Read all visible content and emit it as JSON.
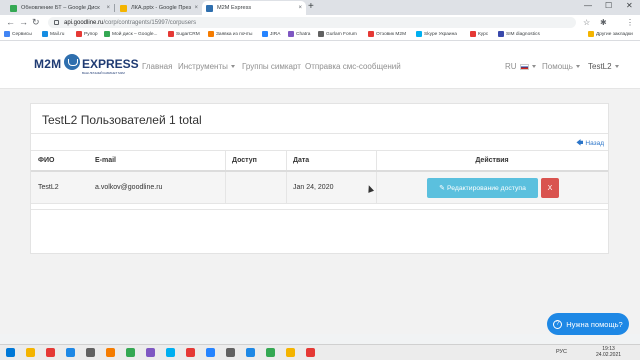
{
  "browser": {
    "tabs": [
      {
        "title": "Обновление БТ – Google Диск",
        "favicon_color": "#34a853",
        "active": false
      },
      {
        "title": "ЛКА.pptx - Google Презентации",
        "favicon_color": "#f4b400",
        "active": false
      },
      {
        "title": "M2M Express",
        "favicon_color": "#2f6fae",
        "active": true
      }
    ],
    "tab_close": "×",
    "new_tab": "+",
    "window_controls": {
      "minimize": "—",
      "maximize": "☐",
      "close": "✕"
    },
    "nav": {
      "back": "←",
      "forward": "→",
      "reload": "↻"
    },
    "url_host": "api.goodline.ru",
    "url_path": "/corp/contragents/15997/corpusers",
    "toolbar_icons": {
      "star": "☆",
      "extensions": "✱",
      "menu": "⋮"
    },
    "bookmarks": [
      {
        "label": "Сервисы",
        "color": "#4285f4"
      },
      {
        "label": "Mail.ru",
        "color": "#168de2"
      },
      {
        "label": "Рупор",
        "color": "#e53935"
      },
      {
        "label": "Мой диск – Google...",
        "color": "#34a853"
      },
      {
        "label": "SugarCRM",
        "color": "#e53935"
      },
      {
        "label": "Заявка из почты",
        "color": "#f57c00"
      },
      {
        "label": "JIRA",
        "color": "#2684ff"
      },
      {
        "label": "Chatra",
        "color": "#7e57c2"
      },
      {
        "label": "Gurlam Forum",
        "color": "#616161"
      },
      {
        "label": "Отзовик M2M",
        "color": "#e53935"
      },
      {
        "label": "Skype Украина",
        "color": "#00aff0"
      },
      {
        "label": "Курс",
        "color": "#e53935"
      },
      {
        "label": "SIM diagnostics",
        "color": "#3949ab"
      },
      {
        "label": "Другие закладки",
        "color": "#f4b400"
      }
    ]
  },
  "navbar": {
    "logo": {
      "m2m": "M2M",
      "express": "EXPRESS",
      "tagline": "ВАШ ЛИЧНЫЙ КАБИНЕТ M2M"
    },
    "links": [
      "Главная",
      "Инструменты",
      "Группы симкарт",
      "Отправка смс-сообщений"
    ],
    "lang": "RU",
    "help": "Помощь",
    "user": "TestL2"
  },
  "panel": {
    "title": "TestL2 Пользователей 1 total",
    "back": "Назад",
    "back_arrow": "🡄",
    "columns": [
      "ФИО",
      "E-mail",
      "Доступ",
      "Дата",
      "Действия"
    ],
    "rows": [
      {
        "name": "TestL2",
        "email": "a.volkov@goodline.ru",
        "access": "",
        "date": "Jan 24, 2020",
        "edit_label": "Редактирование доступа",
        "delete_label": "X"
      }
    ]
  },
  "help_widget": {
    "label": "Нужна помощь?",
    "icon": "?"
  },
  "taskbar": {
    "apps": [
      "#0078d7",
      "#f4b400",
      "#e53935",
      "#1e88e5",
      "#616161",
      "#f57c00",
      "#34a853",
      "#7e57c2",
      "#00aff0",
      "#e53935",
      "#2684ff",
      "#616161",
      "#1e88e5",
      "#34a853",
      "#f4b400",
      "#e53935"
    ],
    "tray": "РУС",
    "time": "19:13",
    "date": "24.02.2021"
  }
}
